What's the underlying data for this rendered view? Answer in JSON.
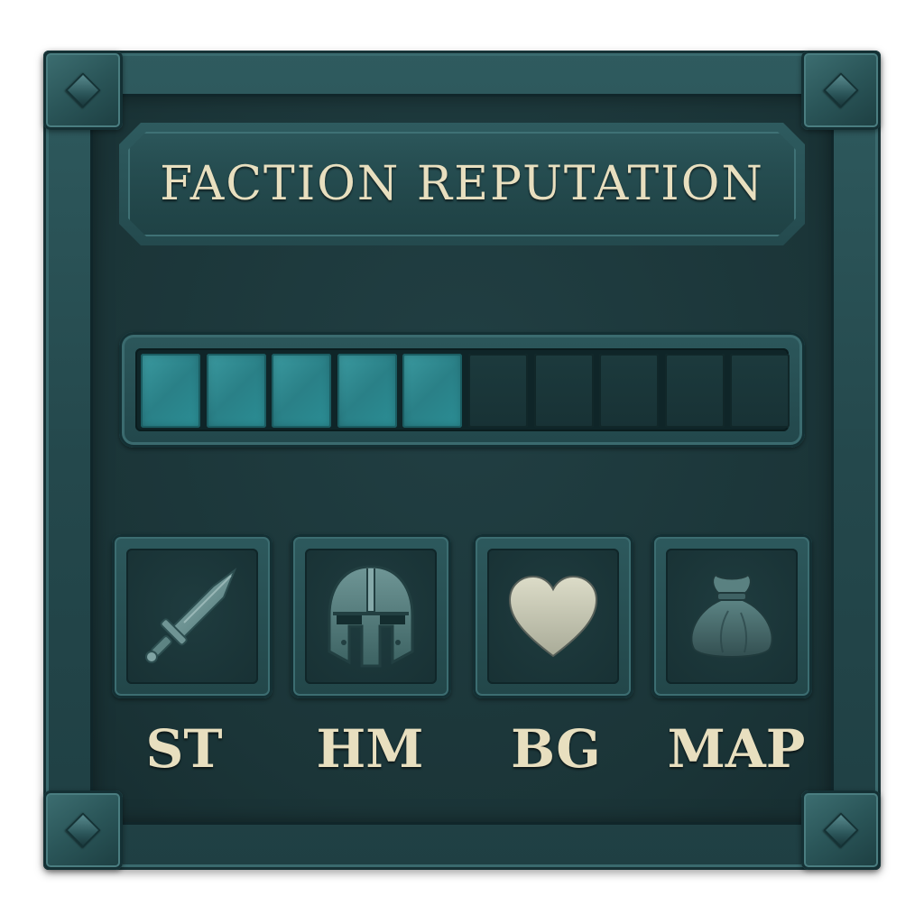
{
  "window": {
    "title": "FACTION REPUTATION"
  },
  "reputation_bar": {
    "filled_segments": 5,
    "total_segments": 10,
    "fill_color": "#2a8087",
    "empty_color": "#183235"
  },
  "slots": [
    {
      "label": "ST",
      "icon": "sword-icon"
    },
    {
      "label": "HM",
      "icon": "helmet-icon"
    },
    {
      "label": "BG",
      "icon": "heart-icon"
    },
    {
      "label": "MAP",
      "icon": "pouch-icon"
    }
  ],
  "theme": {
    "frame_color": "#2f5b5f",
    "panel_color": "#1b3538",
    "text_color": "#e8dfbf"
  }
}
